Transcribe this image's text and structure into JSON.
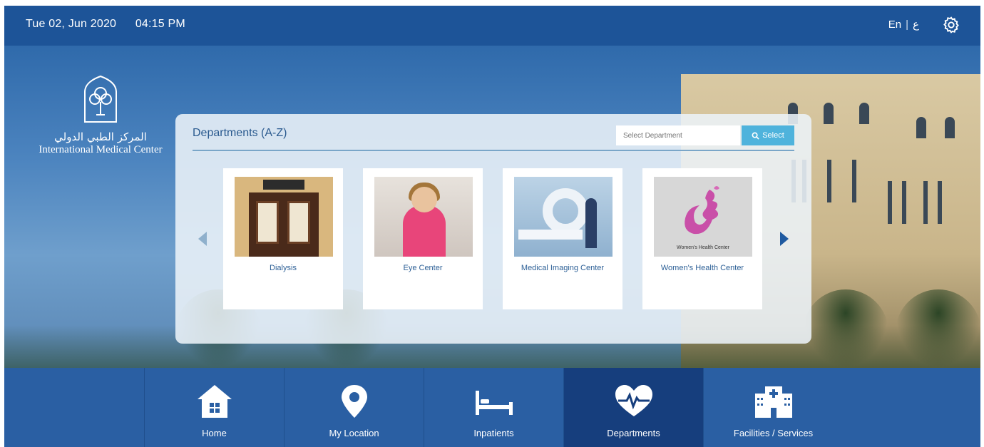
{
  "topbar": {
    "date": "Tue 02, Jun 2020",
    "time": "04:15 PM",
    "lang_en": "En",
    "lang_sep": "|",
    "lang_ar": "ع",
    "settings_icon": "gear-icon"
  },
  "logo": {
    "arabic": "المركز الطبي الدولي",
    "english": "International Medical Center"
  },
  "panel": {
    "title": "Departments (A-Z)",
    "select_placeholder": "Select Department",
    "select_button": "Select",
    "prev_icon": "chevron-left-icon",
    "next_icon": "chevron-right-icon",
    "departments": [
      {
        "label": "Dialysis"
      },
      {
        "label": "Eye Center"
      },
      {
        "label": "Medical Imaging Center"
      },
      {
        "label": "Women's Health Center",
        "thumb_caption": "Women's Health Center"
      }
    ]
  },
  "nav": {
    "items": [
      {
        "label": "Home",
        "icon": "home-icon"
      },
      {
        "label": "My Location",
        "icon": "location-pin-icon"
      },
      {
        "label": "Inpatients",
        "icon": "bed-icon"
      },
      {
        "label": "Departments",
        "icon": "heart-pulse-icon",
        "active": true
      },
      {
        "label": "Facilities / Services",
        "icon": "hospital-icon"
      }
    ]
  },
  "colors": {
    "topbar": "#1d5498",
    "nav": "#2a5fa3",
    "nav_active": "#163e7d",
    "accent": "#4fb3dc",
    "link": "#2c5f96"
  }
}
